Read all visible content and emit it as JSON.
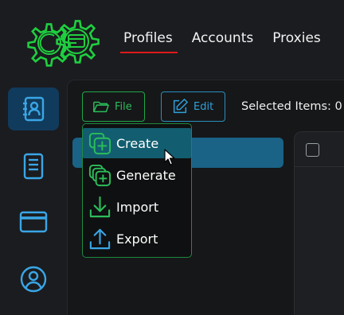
{
  "nav": {
    "tabs": [
      {
        "label": "Profiles",
        "active": true
      },
      {
        "label": "Accounts",
        "active": false
      },
      {
        "label": "Proxies",
        "active": false
      }
    ]
  },
  "sidebar": {
    "items": [
      {
        "icon": "address-book-icon",
        "active": true
      },
      {
        "icon": "notebook-icon",
        "active": false
      },
      {
        "icon": "credit-card-icon",
        "active": false
      },
      {
        "icon": "user-circle-icon",
        "active": false
      }
    ]
  },
  "toolbar": {
    "file_label": "File",
    "edit_label": "Edit",
    "selected_label": "Selected Items: 0"
  },
  "dropdown": {
    "items": [
      {
        "label": "Create",
        "icon": "create-icon"
      },
      {
        "label": "Generate",
        "icon": "generate-icon"
      },
      {
        "label": "Import",
        "icon": "import-icon"
      },
      {
        "label": "Export",
        "icon": "export-icon"
      }
    ]
  },
  "colors": {
    "accent_green": "#1ea64a",
    "accent_blue": "#2a8fbf",
    "active_tab_underline": "#e01a1a",
    "sidebar_active_bg": "#113b5c",
    "dropdown_hover": "#125e70"
  }
}
